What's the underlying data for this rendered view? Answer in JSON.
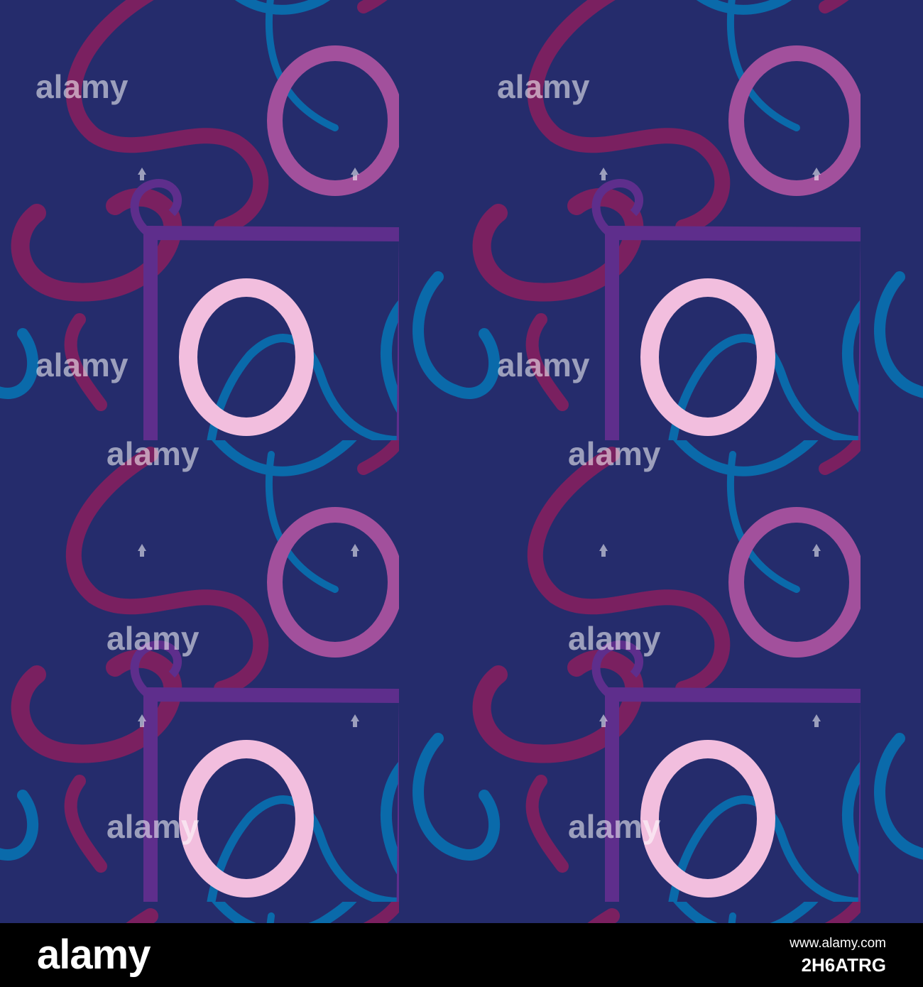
{
  "watermark": {
    "text": "alamy"
  },
  "footer": {
    "logo": "alamy",
    "url": "www.alamy.com",
    "image_id": "2H6ATRG"
  },
  "palette": {
    "background": "#252c6c",
    "square_purple": "#5e2e8c",
    "square_light_pink": "#f2bede",
    "ring_magenta": "#a2509c",
    "swirl_plum": "#7a2060",
    "swirl_blue": "#0a6aaa",
    "ring_light_pink": "#f2bede"
  }
}
